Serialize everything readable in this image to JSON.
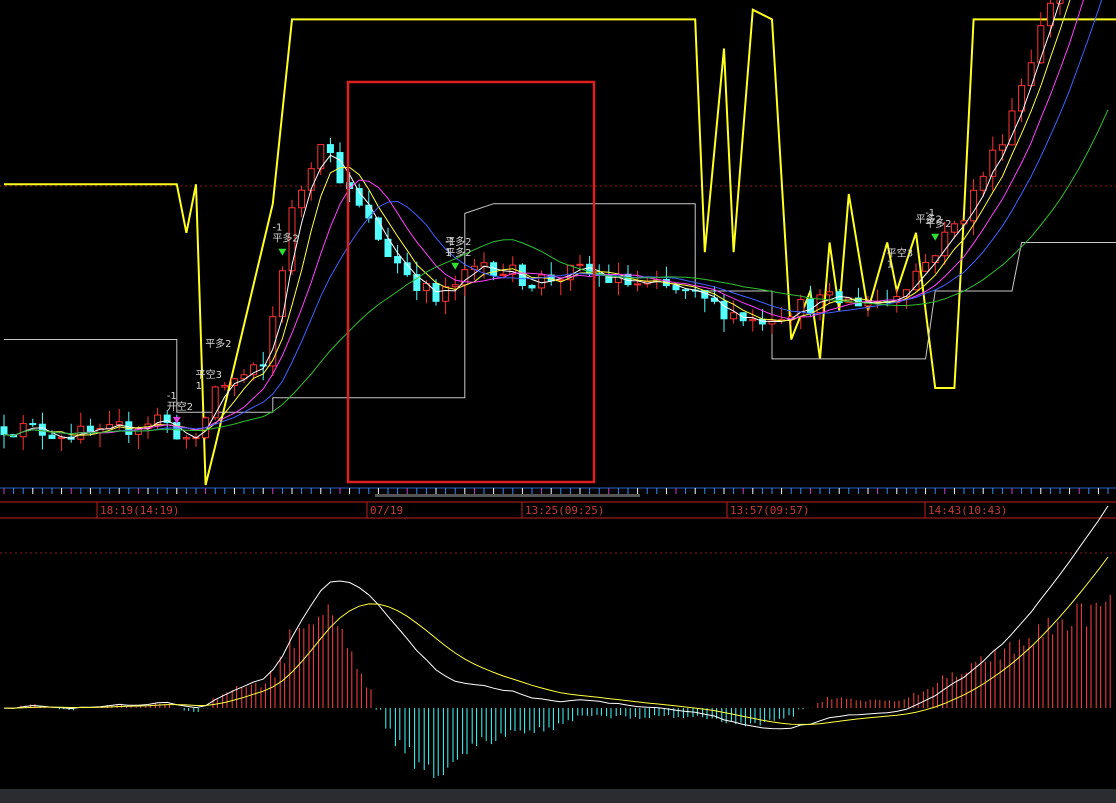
{
  "chart_data": {
    "type": "candlestick",
    "time_labels": [
      "18:19(14:19)",
      "07/19",
      "13:25(09:25)",
      "13:57(09:57)",
      "14:43(10:43)"
    ],
    "signals": [
      {
        "index": 18,
        "lines": [
          "-1",
          "开空2"
        ],
        "color": "#e040e0",
        "dir": "down"
      },
      {
        "index": 22,
        "lines": [
          "平多2"
        ],
        "color": "#d8d8d8",
        "dir": "none"
      },
      {
        "index": 21,
        "lines": [
          "平空3",
          "1"
        ],
        "color": "#d8d8d8",
        "dir": "none"
      },
      {
        "index": 29,
        "lines": [
          "-1",
          "平多2"
        ],
        "color": "#30e030",
        "dir": "down"
      },
      {
        "index": 47,
        "lines": [
          "-1",
          "平多2"
        ],
        "color": "#30e030",
        "dir": "down"
      },
      {
        "index": 47,
        "lines": [
          "平多2",
          "1"
        ],
        "color": "#d8d8d8",
        "dir": "none"
      },
      {
        "index": 96,
        "lines": [
          "平多2"
        ],
        "color": "#d8d8d8",
        "dir": "none"
      },
      {
        "index": 93,
        "lines": [
          "平空3",
          "1"
        ],
        "color": "#d8d8d8",
        "dir": "none"
      },
      {
        "index": 97,
        "lines": [
          "-1",
          "平多2"
        ],
        "color": "#30e030",
        "dir": "down"
      }
    ],
    "price_ylim": [
      0,
      100
    ],
    "macd_ylim": [
      -10,
      22
    ]
  }
}
